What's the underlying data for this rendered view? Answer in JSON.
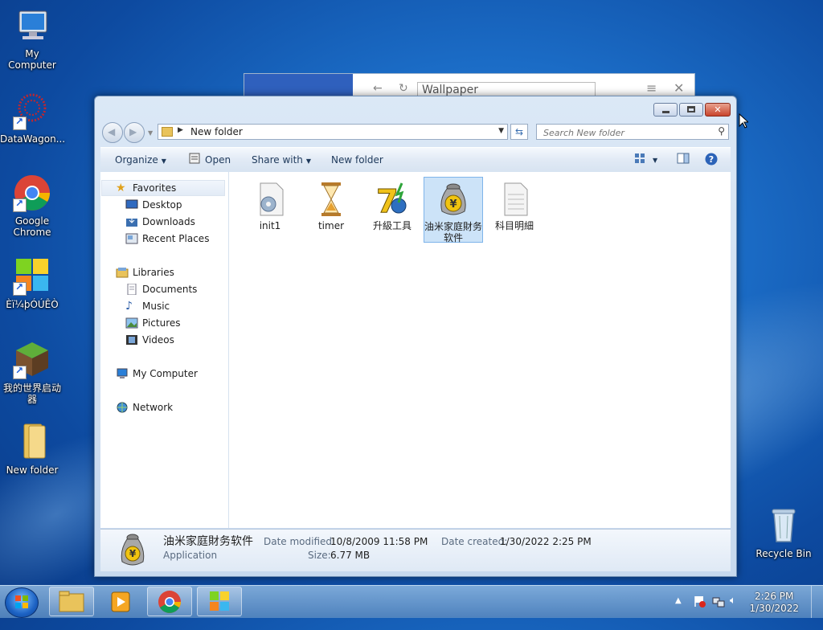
{
  "desktop": {
    "icons": [
      {
        "label": "My Computer",
        "icon": "computer-icon"
      },
      {
        "label": "DataWagon...",
        "icon": "datawagon-icon"
      },
      {
        "label": "Google Chrome",
        "icon": "chrome-icon"
      },
      {
        "label": "Èï¼þÓÚÊÒ",
        "icon": "tiles-icon"
      },
      {
        "label": "我的世界启动器",
        "icon": "minecraft-icon"
      },
      {
        "label": "New folder",
        "icon": "folder-icon"
      },
      {
        "label": "Recycle Bin",
        "icon": "recycle-bin-icon"
      }
    ]
  },
  "back_window": {
    "search_value": "Wallpaper"
  },
  "explorer": {
    "breadcrumb": "New folder",
    "search_placeholder": "Search New folder",
    "toolbar": {
      "organize": "Organize",
      "open": "Open",
      "share_with": "Share with",
      "new_folder": "New folder"
    },
    "nav": {
      "favorites": "Favorites",
      "desktop": "Desktop",
      "downloads": "Downloads",
      "recent_places": "Recent Places",
      "libraries": "Libraries",
      "documents": "Documents",
      "music": "Music",
      "pictures": "Pictures",
      "videos": "Videos",
      "my_computer": "My Computer",
      "network": "Network"
    },
    "files": [
      {
        "name": "init1",
        "icon": "settings-file-icon",
        "selected": false
      },
      {
        "name": "timer",
        "icon": "hourglass-icon",
        "selected": false
      },
      {
        "name": "升級工具",
        "icon": "upgrade-tool-icon",
        "selected": false
      },
      {
        "name": "油米家庭財务软件",
        "icon": "money-bag-icon",
        "selected": true
      },
      {
        "name": "科目明細",
        "icon": "text-file-icon",
        "selected": false
      }
    ],
    "details": {
      "name": "油米家庭財务软件",
      "type": "Application",
      "date_modified_label": "Date modified:",
      "date_modified": "10/8/2009 11:58 PM",
      "size_label": "Size:",
      "size": "6.77 MB",
      "date_created_label": "Date created:",
      "date_created": "1/30/2022 2:25 PM"
    }
  },
  "taskbar": {
    "time": "2:26 PM",
    "date": "1/30/2022"
  }
}
